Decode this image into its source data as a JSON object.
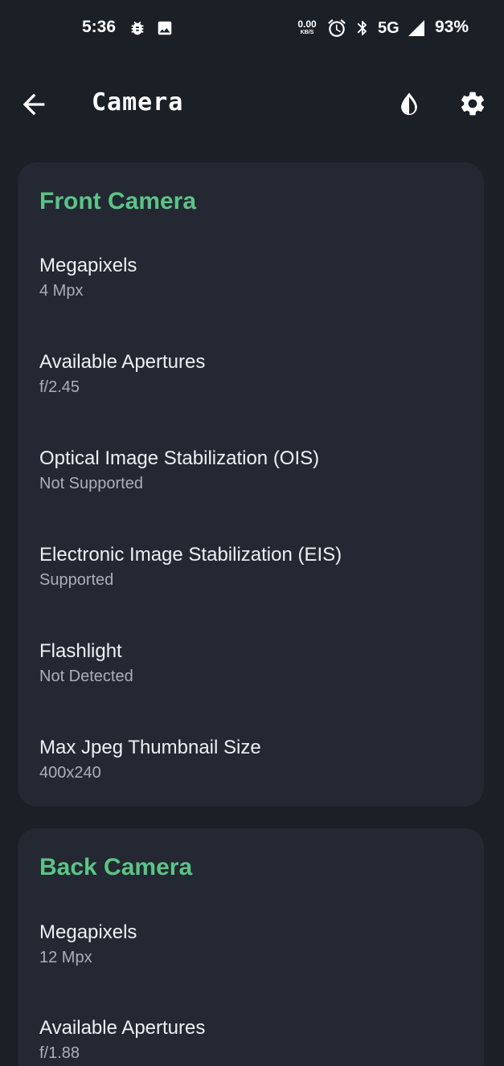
{
  "status_bar": {
    "time": "5:36",
    "net_speed_value": "0.00",
    "net_speed_unit": "KB/S",
    "network": "5G",
    "battery": "93%",
    "icons": [
      "bug-icon",
      "image-icon",
      "alarm-icon",
      "bluetooth-icon",
      "signal-icon"
    ]
  },
  "app_bar": {
    "title": "Camera",
    "icons": [
      "back-arrow-icon",
      "contrast-icon",
      "gear-icon"
    ]
  },
  "front_camera": {
    "title": "Front Camera",
    "items": [
      {
        "label": "Megapixels",
        "value": "4 Mpx"
      },
      {
        "label": "Available Apertures",
        "value": "f/2.45"
      },
      {
        "label": "Optical Image Stabilization (OIS)",
        "value": "Not Supported"
      },
      {
        "label": "Electronic Image Stabilization (EIS)",
        "value": "Supported"
      },
      {
        "label": "Flashlight",
        "value": "Not Detected"
      },
      {
        "label": "Max Jpeg Thumbnail Size",
        "value": "400x240"
      }
    ]
  },
  "back_camera": {
    "title": "Back Camera",
    "items": [
      {
        "label": "Megapixels",
        "value": "12 Mpx"
      },
      {
        "label": "Available Apertures",
        "value": "f/1.88"
      }
    ]
  },
  "colors": {
    "background": "#1b1f26",
    "card": "#232833",
    "accent_green": "#5cc485",
    "text_primary": "#eef0f2",
    "text_secondary": "#aab0b8"
  }
}
